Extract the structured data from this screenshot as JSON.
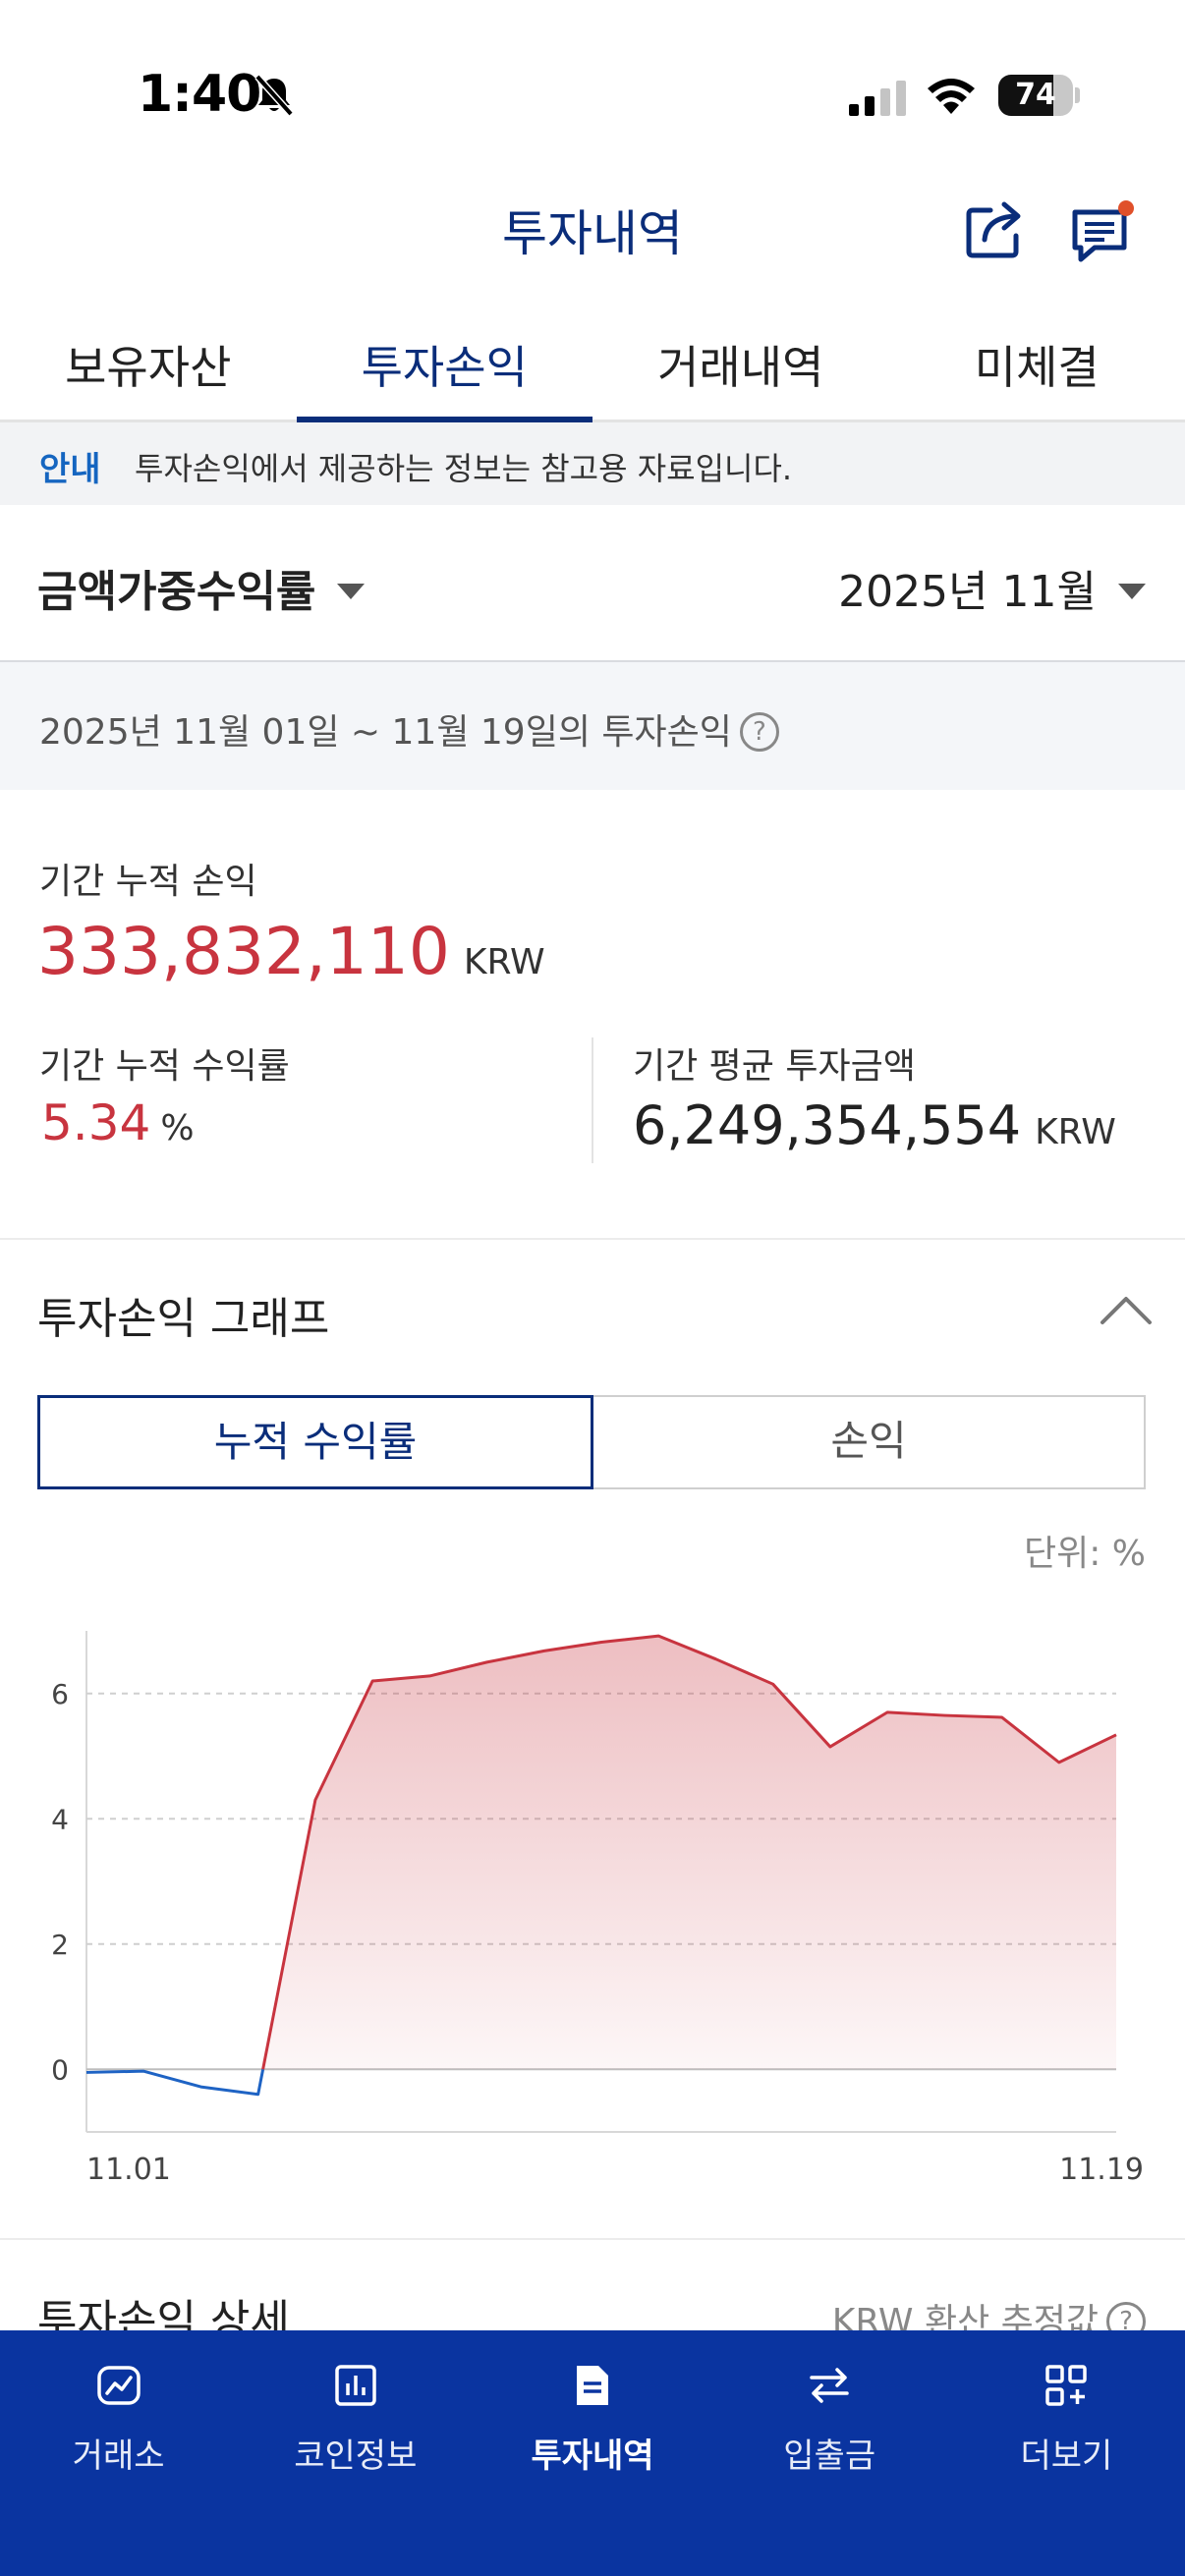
{
  "status_bar": {
    "time": "1:40",
    "battery": "74",
    "battery_level": 0.74
  },
  "header": {
    "title": "투자내역"
  },
  "tabs": [
    {
      "label": "보유자산"
    },
    {
      "label": "투자손익"
    },
    {
      "label": "거래내역"
    },
    {
      "label": "미체결"
    }
  ],
  "active_tab": "투자손익",
  "notice": {
    "label": "안내",
    "text": "투자손익에서 제공하는 정보는 참고용 자료입니다."
  },
  "filter": {
    "type_label": "금액가중수익률",
    "month_label": "2025년 11월"
  },
  "period": {
    "text": "2025년 11월 01일 ~ 11월 19일의 투자손익",
    "help": "?"
  },
  "summary": {
    "cumulative_pl_label": "기간 누적 손익",
    "cumulative_pl_value": "333,832,110",
    "cumulative_pl_unit": "KRW",
    "cumulative_rate_label": "기간 누적 수익률",
    "cumulative_rate_value": "5.34",
    "cumulative_rate_unit": "%",
    "avg_investment_label": "기간 평균 투자금액",
    "avg_investment_value": "6,249,354,554",
    "avg_investment_unit": "KRW"
  },
  "graph": {
    "title": "투자손익 그래프",
    "toggle": [
      "누적 수익률",
      "손익"
    ],
    "unit_label": "단위: %"
  },
  "detail": {
    "title": "투자손익 상세",
    "note": "KRW 환산 추정값"
  },
  "bottom_nav": [
    {
      "label": "거래소",
      "icon": "exchange-chart-icon"
    },
    {
      "label": "코인정보",
      "icon": "coin-info-icon"
    },
    {
      "label": "투자내역",
      "icon": "document-icon"
    },
    {
      "label": "입출금",
      "icon": "transfer-arrows-icon"
    },
    {
      "label": "더보기",
      "icon": "more-grid-icon"
    }
  ],
  "colors": {
    "brand_navy": "#0a2d7a",
    "nav_blue": "#0a34a0",
    "profit_red": "#c8343f",
    "loss_blue": "#1e63c4"
  },
  "chart_data": {
    "type": "area",
    "x": [
      "11.01",
      "11.02",
      "11.03",
      "11.04",
      "11.05",
      "11.06",
      "11.07",
      "11.08",
      "11.09",
      "11.10",
      "11.11",
      "11.12",
      "11.13",
      "11.14",
      "11.15",
      "11.16",
      "11.17",
      "11.18",
      "11.19"
    ],
    "values": [
      -0.05,
      -0.03,
      -0.28,
      -0.4,
      4.3,
      6.2,
      6.28,
      6.5,
      6.68,
      6.82,
      6.92,
      6.55,
      6.15,
      5.15,
      5.7,
      5.65,
      5.62,
      4.9,
      5.34
    ],
    "x_tick_labels": [
      "11.01",
      "11.19"
    ],
    "y_ticks": [
      0,
      2,
      4,
      6
    ],
    "ylim": [
      -1,
      7
    ],
    "grid": "horizontal dashed",
    "positive_color": "#c8343f",
    "negative_color": "#1e63c4",
    "xlabel": "",
    "ylabel": ""
  }
}
